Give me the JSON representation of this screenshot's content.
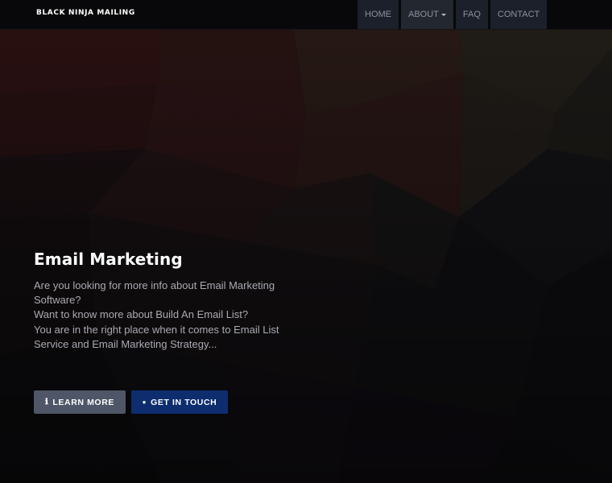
{
  "navbar": {
    "brand": "BLACK NINJA MAILING",
    "items": [
      {
        "label": "HOME"
      },
      {
        "label": "ABOUT",
        "has_dropdown": true,
        "active": true
      },
      {
        "label": "FAQ"
      },
      {
        "label": "CONTACT"
      }
    ]
  },
  "hero": {
    "title": "Email Marketing",
    "lines": [
      "Are you looking for more info about Email Marketing Software?",
      "Want to know more about Build An Email List?",
      "You are in the right place when it comes to Email List Service and Email Marketing Strategy..."
    ]
  },
  "buttons": {
    "learn_more": {
      "label": "LEARN MORE",
      "icon": "info-icon"
    },
    "get_in_touch": {
      "label": "GET IN TOUCH",
      "icon": "info-circle-icon"
    }
  },
  "colors": {
    "navbar_bg": "#08080a",
    "learn_more_bg": "#4e5667",
    "get_in_touch_bg": "#0d2d6e",
    "title": "#ffffff",
    "body_text": "#a9aab2"
  }
}
